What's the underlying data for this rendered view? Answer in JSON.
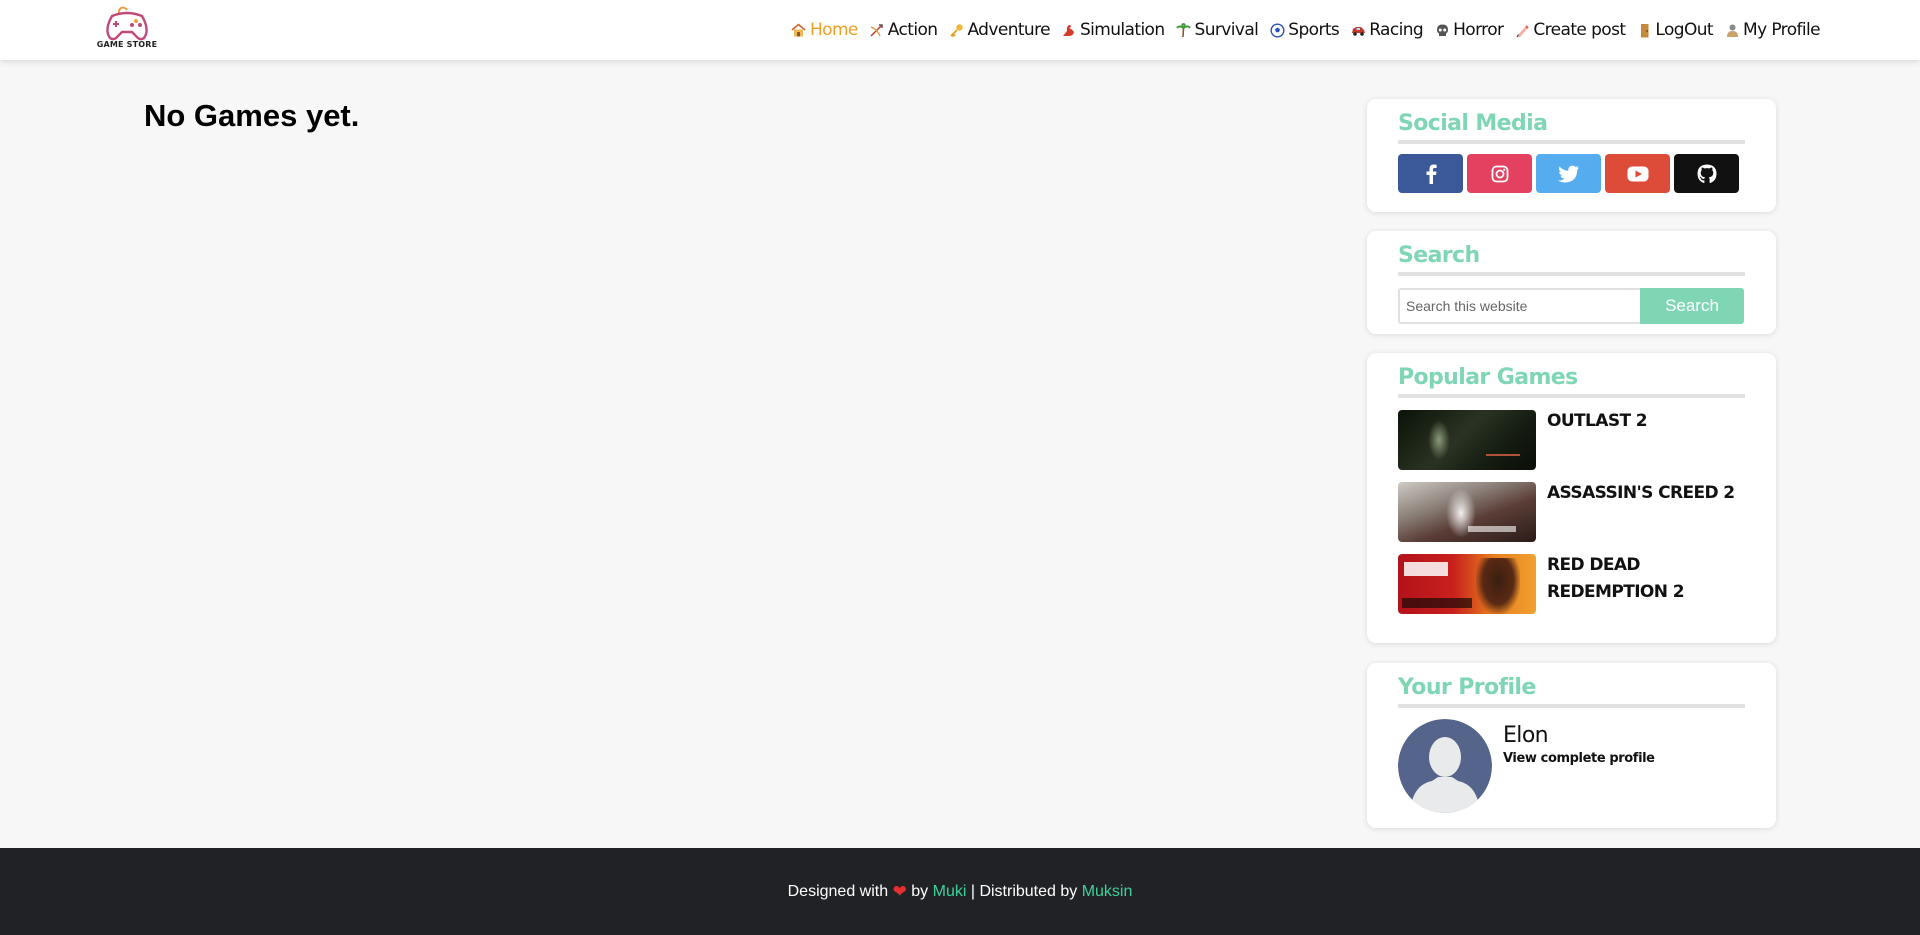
{
  "brand": {
    "logo_text": "GAME STORE"
  },
  "nav": {
    "items": [
      {
        "label": "Home",
        "icon": "house-icon",
        "active": true
      },
      {
        "label": "Action",
        "icon": "bow-arrow-icon"
      },
      {
        "label": "Adventure",
        "icon": "key-icon"
      },
      {
        "label": "Simulation",
        "icon": "flexed-bicep-icon"
      },
      {
        "label": "Survival",
        "icon": "palm-tree-icon"
      },
      {
        "label": "Sports",
        "icon": "soccer-ball-icon"
      },
      {
        "label": "Racing",
        "icon": "car-icon"
      },
      {
        "label": "Horror",
        "icon": "skull-icon"
      },
      {
        "label": "Create post",
        "icon": "pencil-icon"
      },
      {
        "label": "LogOut",
        "icon": "door-icon"
      },
      {
        "label": "My Profile",
        "icon": "user-icon"
      }
    ]
  },
  "main": {
    "empty_message": "No Games yet."
  },
  "sidebar": {
    "social": {
      "title": "Social Media",
      "buttons": [
        {
          "icon": "facebook-icon",
          "color": "#3b5998"
        },
        {
          "icon": "instagram-icon",
          "color": "#e4405f"
        },
        {
          "icon": "twitter-icon",
          "color": "#55acee"
        },
        {
          "icon": "youtube-icon",
          "color": "#dd4b39"
        },
        {
          "icon": "github-icon",
          "color": "#111111"
        }
      ]
    },
    "search": {
      "title": "Search",
      "placeholder": "Search this website",
      "button_label": "Search"
    },
    "popular": {
      "title": "Popular Games",
      "games": [
        {
          "title": "OUTLAST 2"
        },
        {
          "title": "ASSASSIN'S CREED 2"
        },
        {
          "title": "RED DEAD REDEMPTION 2"
        }
      ]
    },
    "profile": {
      "title": "Your Profile",
      "name": "Elon",
      "link_label": "View complete profile"
    }
  },
  "footer": {
    "prefix": "Designed with ",
    "by_text": " by ",
    "author": "Muki",
    "separator": " | Distributed by ",
    "distributor": "Muksin"
  },
  "colors": {
    "accent": "#7fd6b4",
    "active_nav": "#f0a020",
    "footer_bg": "#212226",
    "footer_link": "#3cd39a"
  }
}
